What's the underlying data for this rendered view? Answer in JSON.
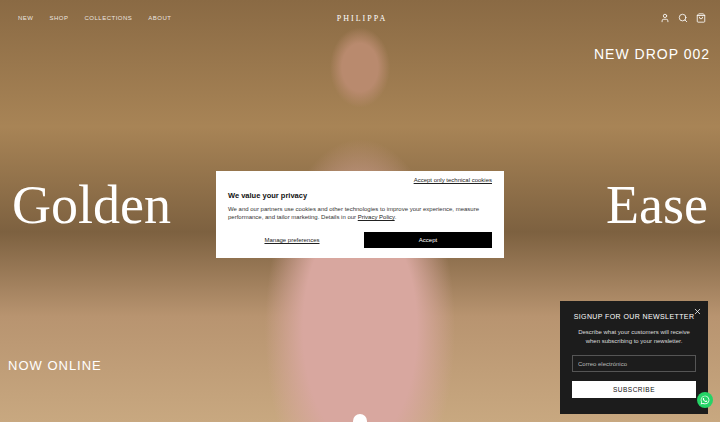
{
  "header": {
    "logo": "PHILIPPA",
    "nav": [
      "NEW",
      "SHOP",
      "COLLECTIONS",
      "ABOUT"
    ]
  },
  "hero": {
    "eyebrow": "NEW DROP 002",
    "title_left": "Golden",
    "title_right": "Ease",
    "footer": "NOW ONLINE",
    "slides": [
      {
        "selected": true
      }
    ]
  },
  "cookie_banner": {
    "technical_link": "Accept only technical cookies",
    "title": "We value your privacy",
    "body": "We and our partners use cookies and other technologies to improve your experience, measure performance, and tailor marketing. Details in our",
    "policy_link": "Privacy Policy",
    "policy_suffix": ".",
    "manage": "Manage preferences",
    "accept": "Accept"
  },
  "newsletter": {
    "title": "SIGNUP FOR OUR NEWSLETTER",
    "description": "Describe what your customers will receive when subscribing to your newsletter.",
    "placeholder": "Correo electrónico",
    "button": "SUBSCRIBE"
  }
}
